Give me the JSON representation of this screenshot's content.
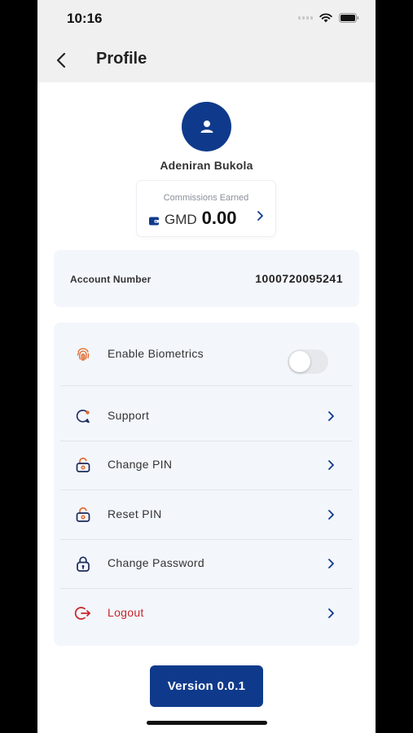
{
  "status_bar": {
    "time": "10:16"
  },
  "header": {
    "title": "Profile"
  },
  "profile": {
    "name": "Adeniran Bukola"
  },
  "commission": {
    "label": "Commissions Earned",
    "currency": "GMD",
    "amount": "0.00"
  },
  "account": {
    "label": "Account Number",
    "value": "1000720095241"
  },
  "menu": {
    "items": [
      {
        "label": "Enable Biometrics",
        "icon": "fingerprint-icon",
        "type": "toggle",
        "enabled": false
      },
      {
        "label": "Support",
        "icon": "support-icon"
      },
      {
        "label": "Change PIN",
        "icon": "unlock-icon"
      },
      {
        "label": "Reset PIN",
        "icon": "unlock-icon"
      },
      {
        "label": "Change Password",
        "icon": "lock-icon"
      },
      {
        "label": "Logout",
        "icon": "logout-icon"
      }
    ]
  },
  "footer": {
    "version": "Version 0.0.1"
  },
  "colors": {
    "primary": "#0f3a8c",
    "logout": "#c8262b",
    "accent_orange": "#e2682a",
    "card_bg": "#f3f6fb"
  }
}
